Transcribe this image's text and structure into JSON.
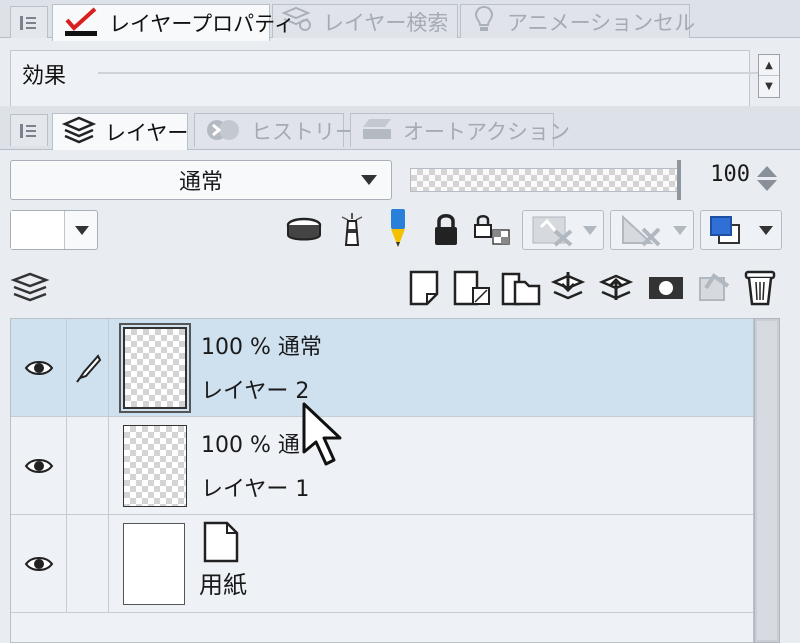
{
  "top_tabs": [
    {
      "label": "レイヤープロパティ",
      "icon": "pen-check-icon",
      "active": true
    },
    {
      "label": "レイヤー検索",
      "icon": "layer-search-icon",
      "active": false
    },
    {
      "label": "アニメーションセル",
      "icon": "lightbulb-icon",
      "active": false
    }
  ],
  "effect": {
    "label": "効果"
  },
  "mid_tabs": [
    {
      "label": "レイヤー",
      "icon": "layers-icon",
      "active": true
    },
    {
      "label": "ヒストリー",
      "icon": "history-icon",
      "active": false
    },
    {
      "label": "オートアクション",
      "icon": "auto-action-icon",
      "active": false
    }
  ],
  "layer_panel": {
    "blend_mode": "通常",
    "opacity": "100",
    "opacity_fraction": 1.0
  },
  "layers": [
    {
      "mode": "100 % 通常",
      "name": "レイヤー 2",
      "selected": true,
      "visible": true,
      "edit_icon": "pen-nib-icon"
    },
    {
      "mode": "100 % 通",
      "name": "レイヤー 1",
      "selected": false,
      "visible": true
    },
    {
      "mode": "",
      "name": "用紙",
      "selected": false,
      "visible": true,
      "paper": true
    }
  ],
  "colors": {
    "accent_blue": "#2f6fd6",
    "selection": "#cfe0ef",
    "pencil_yellow": "#f2c200",
    "pencil_blue": "#2a7fd8"
  }
}
